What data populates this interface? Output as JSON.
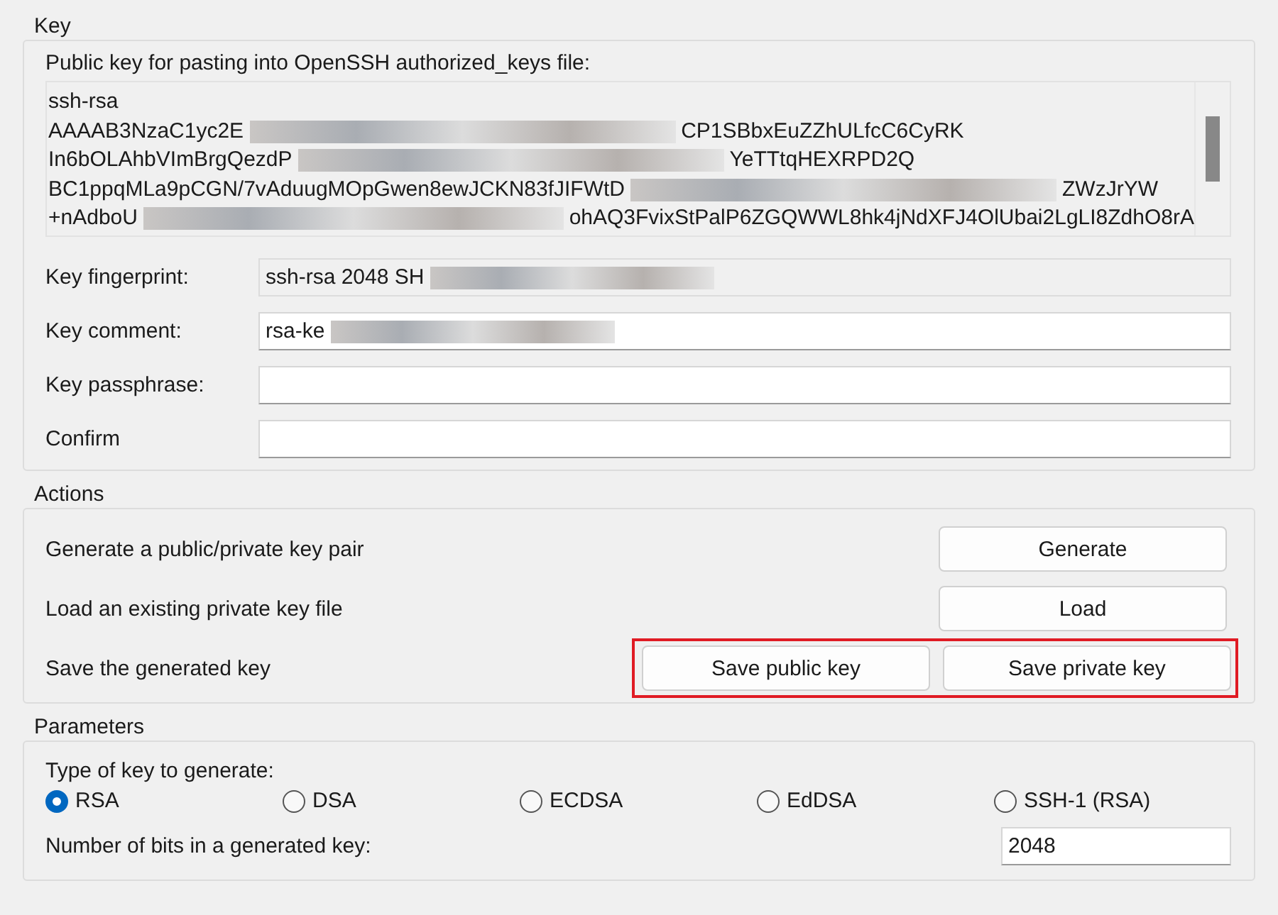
{
  "key_group": {
    "title": "Key",
    "public_key_label": "Public key for pasting into OpenSSH authorized_keys file:",
    "public_key_lines": [
      {
        "left": "ssh-rsa",
        "redacted": false
      },
      {
        "left": "AAAAB3NzaC1yc2E",
        "redacted": true,
        "right": "CP1SBbxEuZZhULfcC6CyRK"
      },
      {
        "left": "In6bOLAhbVImBrgQezdP",
        "redacted": true,
        "right": "YeTTtqHEXRPD2Q"
      },
      {
        "left": "BC1ppqMLa9pCGN/7vAduugMOpGwen8ewJCKN83fJIFWtD",
        "redacted": true,
        "right": "ZWzJrYW"
      },
      {
        "left": "+nAdboU",
        "redacted": true,
        "right": "ohAQ3FvixStPalP6ZGQWWL8hk4jNdXFJ4OlUbai2LgLI8ZdhO8rA"
      }
    ],
    "fields": [
      {
        "label": "Key fingerprint:",
        "value": "ssh-rsa 2048 SH",
        "redacted": true,
        "readonly": true
      },
      {
        "label": "Key comment:",
        "value": "rsa-ke",
        "redacted": true,
        "readonly": false
      },
      {
        "label": "Key passphrase:",
        "redacted": false,
        "readonly": false
      },
      {
        "label": "Confirm",
        "redacted": false,
        "readonly": false
      }
    ]
  },
  "actions_group": {
    "title": "Actions",
    "rows": [
      {
        "label": "Generate a public/private key pair",
        "buttons": [
          "Generate"
        ],
        "highlighted": false
      },
      {
        "label": "Load an existing private key file",
        "buttons": [
          "Load"
        ],
        "highlighted": false
      },
      {
        "label": "Save the generated key",
        "buttons": [
          "Save public key",
          "Save private key"
        ],
        "highlighted": true
      }
    ]
  },
  "parameters_group": {
    "title": "Parameters",
    "key_type_label": "Type of key to generate:",
    "key_types": [
      {
        "label": "RSA",
        "selected": true
      },
      {
        "label": "DSA",
        "selected": false
      },
      {
        "label": "ECDSA",
        "selected": false
      },
      {
        "label": "EdDSA",
        "selected": false
      },
      {
        "label": "SSH-1 (RSA)",
        "selected": false
      }
    ],
    "bits_label": "Number of bits in a generated key:",
    "bits_value": "2048"
  }
}
